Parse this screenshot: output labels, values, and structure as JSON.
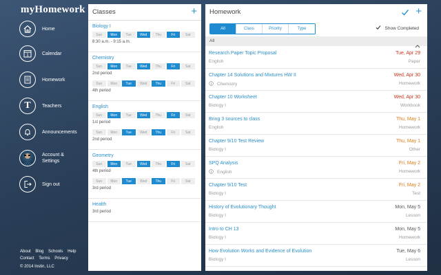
{
  "app": {
    "brand": "myHomework"
  },
  "sidebar": {
    "items": [
      {
        "label": "Home",
        "icon": "home-icon"
      },
      {
        "label": "Calendar",
        "icon": "calendar-icon",
        "badge": "1"
      },
      {
        "label": "Homework",
        "icon": "homework-icon"
      },
      {
        "label": "Teachers",
        "icon": "teachers-icon",
        "glyph": "T"
      },
      {
        "label": "Announcements",
        "icon": "bell-icon"
      },
      {
        "label_line1": "Account &",
        "label_line2": "Settings",
        "icon": "avatar"
      },
      {
        "label": "Sign out",
        "icon": "sign-out-icon"
      }
    ],
    "footer_row1": [
      "About",
      "Blog",
      "Schools",
      "Help"
    ],
    "footer_row2": [
      "Contact",
      "Terms",
      "Privacy"
    ],
    "copyright": "© 2014 Instin, LLC"
  },
  "classes_panel": {
    "title": "Classes",
    "add_label": "+",
    "day_labels": [
      "Sun",
      "Mon",
      "Tue",
      "Wed",
      "Thu",
      "Fri",
      "Sat"
    ],
    "classes": [
      {
        "name": "Biology I",
        "schedules": [
          {
            "days": [
              false,
              true,
              false,
              true,
              false,
              true,
              false
            ],
            "period": "8:30 a.m. - 9:15 a.m."
          }
        ]
      },
      {
        "name": "Chemistry",
        "schedules": [
          {
            "days": [
              false,
              true,
              false,
              true,
              false,
              true,
              false
            ],
            "period": "2nd period"
          },
          {
            "days": [
              false,
              false,
              true,
              false,
              true,
              false,
              false
            ],
            "period": "4th period"
          }
        ]
      },
      {
        "name": "English",
        "schedules": [
          {
            "days": [
              false,
              true,
              false,
              true,
              false,
              true,
              false
            ],
            "period": "1st period"
          },
          {
            "days": [
              false,
              false,
              true,
              false,
              true,
              false,
              false
            ],
            "period": "2nd period"
          }
        ]
      },
      {
        "name": "Geometry",
        "schedules": [
          {
            "days": [
              false,
              true,
              false,
              true,
              false,
              true,
              false
            ],
            "period": "4th period"
          },
          {
            "days": [
              false,
              false,
              true,
              false,
              true,
              false,
              false
            ],
            "period": "3rd period"
          }
        ]
      },
      {
        "name": "Health",
        "schedules": [
          {
            "days": null,
            "period": "3rd period"
          }
        ]
      }
    ]
  },
  "homework_panel": {
    "title": "Homework",
    "add_label": "+",
    "filters": [
      "All",
      "Class",
      "Priority",
      "Type"
    ],
    "active_filter": "All",
    "show_completed_label": "Show Completed",
    "show_completed_checked": true,
    "group_label": "All",
    "colors": {
      "overdue": "#c8341f",
      "soon": "#de7a12",
      "normal": "#555555",
      "accent": "#1e8ad0"
    },
    "items": [
      {
        "title": "Research Paper Topic Proposal",
        "class": "English",
        "date": "Tue, Apr 29",
        "type": "Paper",
        "status": "overdue",
        "info": false
      },
      {
        "title": "Chapter 14 Solutions and Mixtures HW II",
        "class": "Chemistry",
        "date": "Wed, Apr 30",
        "type": "Homework",
        "status": "overdue",
        "info": true
      },
      {
        "title": "Chapter 10 Worksheet",
        "class": "Biology I",
        "date": "Wed, Apr 30",
        "type": "Workbook",
        "status": "overdue",
        "info": false
      },
      {
        "title": "Bring 3 sources to class",
        "class": "English",
        "date": "Thu, May 1",
        "type": "Homework",
        "status": "soon",
        "info": false
      },
      {
        "title": "Chapter 9/10 Test Review",
        "class": "Biology I",
        "date": "Thu, May 1",
        "type": "Other",
        "status": "soon",
        "info": false
      },
      {
        "title": "SPQ Analysis",
        "class": "English",
        "date": "Fri, May 2",
        "type": "Homework",
        "status": "soon",
        "info": true
      },
      {
        "title": "Chapter 9/10 Test",
        "class": "Biology I",
        "date": "Fri, May 2",
        "type": "Test",
        "status": "soon",
        "info": false
      },
      {
        "title": "History of Evolutionary Thought",
        "class": "Biology I",
        "date": "Mon, May 5",
        "type": "Lesson",
        "status": "normal",
        "info": false
      },
      {
        "title": "Intro to CH 13",
        "class": "Biology I",
        "date": "Mon, May 5",
        "type": "Homework",
        "status": "normal",
        "info": false
      },
      {
        "title": "How Evolution Works and Evidence of Evolution",
        "class": "Biology I",
        "date": "Tue, May 6",
        "type": "Lesson",
        "status": "normal",
        "info": false
      }
    ]
  }
}
